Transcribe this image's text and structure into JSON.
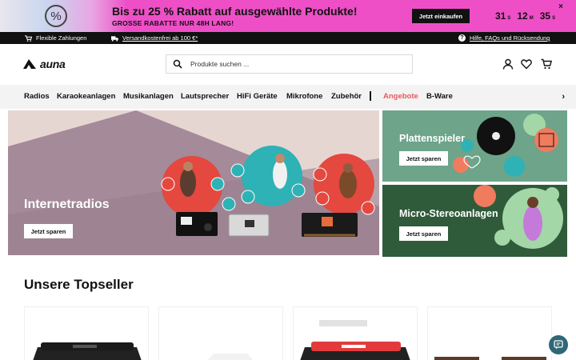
{
  "promo": {
    "icon": "percent-icon",
    "symbol": "%",
    "title": "Bis zu 25 % Rabatt auf ausgewählte Produkte!",
    "subtitle": "GROSSE RABATTE NUR 48H LANG!",
    "cta": "Jetzt einkaufen",
    "countdown": [
      {
        "value": "31",
        "unit": "S"
      },
      {
        "value": "12",
        "unit": "M"
      },
      {
        "value": "35",
        "unit": "S"
      }
    ],
    "close": "×",
    "background_color": "#ee4fc7"
  },
  "infobar": {
    "payment": "Flexible Zahlungen",
    "shipping": "Versandkostenfrei ab 100 €*",
    "help": "Hilfe, FAQs und Rücksendung",
    "help_symbol": "?"
  },
  "header": {
    "logo_text": "auna",
    "search_placeholder": "Produkte suchen ...",
    "icons": [
      "user-icon",
      "heart-icon",
      "cart-icon"
    ]
  },
  "categories": [
    "Radios",
    "Karaokeanlagen",
    "Musikanlagen",
    "Lautsprecher",
    "HiFi Geräte",
    "Mikrofone",
    "Zubehör"
  ],
  "categories_extra": {
    "separator": "|",
    "sale": "Angebote",
    "bware": "B-Ware",
    "sale_color": "#e8595f",
    "next": "›"
  },
  "banners": {
    "hero": {
      "title": "Internetradios",
      "button": "Jetzt sparen"
    },
    "side": [
      {
        "title": "Plattenspieler",
        "button": "Jetzt sparen"
      },
      {
        "title": "Micro-Stereoanlagen",
        "button": "Jetzt sparen"
      }
    ]
  },
  "topseller": {
    "title": "Unsere Topseller"
  },
  "chat": {
    "icon": "chat-icon"
  }
}
